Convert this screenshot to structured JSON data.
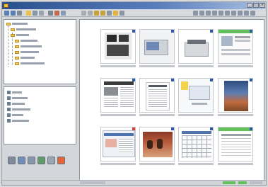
{
  "window": {
    "title": "",
    "buttons": [
      "_",
      "□",
      "×"
    ]
  },
  "toolbar": {
    "icons": [
      "back-icon",
      "forward-icon",
      "up-icon",
      "folder-icon",
      "view-icon",
      "print-icon",
      "search-icon",
      "settings-icon",
      "help-icon"
    ]
  },
  "colors": {
    "title_start": "#2a4f8f",
    "title_end": "#aac0e0",
    "selection_badge": "#2f57a8",
    "folder": "#f0c850",
    "green_bar": "#62c15a"
  },
  "sidebar": {
    "tree_items": [
      "",
      "",
      "",
      "",
      "",
      "",
      "",
      ""
    ],
    "list_items": [
      "",
      "",
      "",
      "",
      "",
      ""
    ],
    "action_buttons": [
      "rotate-icon",
      "copy-icon",
      "gallery-icon",
      "email-icon",
      "print-icon",
      "delete-icon"
    ]
  },
  "thumbnails": [
    {
      "kind": "document-screen",
      "caption": ""
    },
    {
      "kind": "computer-photo",
      "caption": ""
    },
    {
      "kind": "printer-photo",
      "caption": ""
    },
    {
      "kind": "newsletter",
      "caption": ""
    },
    {
      "kind": "newspaper",
      "caption": ""
    },
    {
      "kind": "article",
      "caption": ""
    },
    {
      "kind": "note-sketch",
      "caption": ""
    },
    {
      "kind": "magazine-cover",
      "caption": ""
    },
    {
      "kind": "webpage",
      "caption": ""
    },
    {
      "kind": "people-photo",
      "caption": ""
    },
    {
      "kind": "calendar-grid",
      "caption": ""
    },
    {
      "kind": "web-form",
      "caption": ""
    }
  ]
}
